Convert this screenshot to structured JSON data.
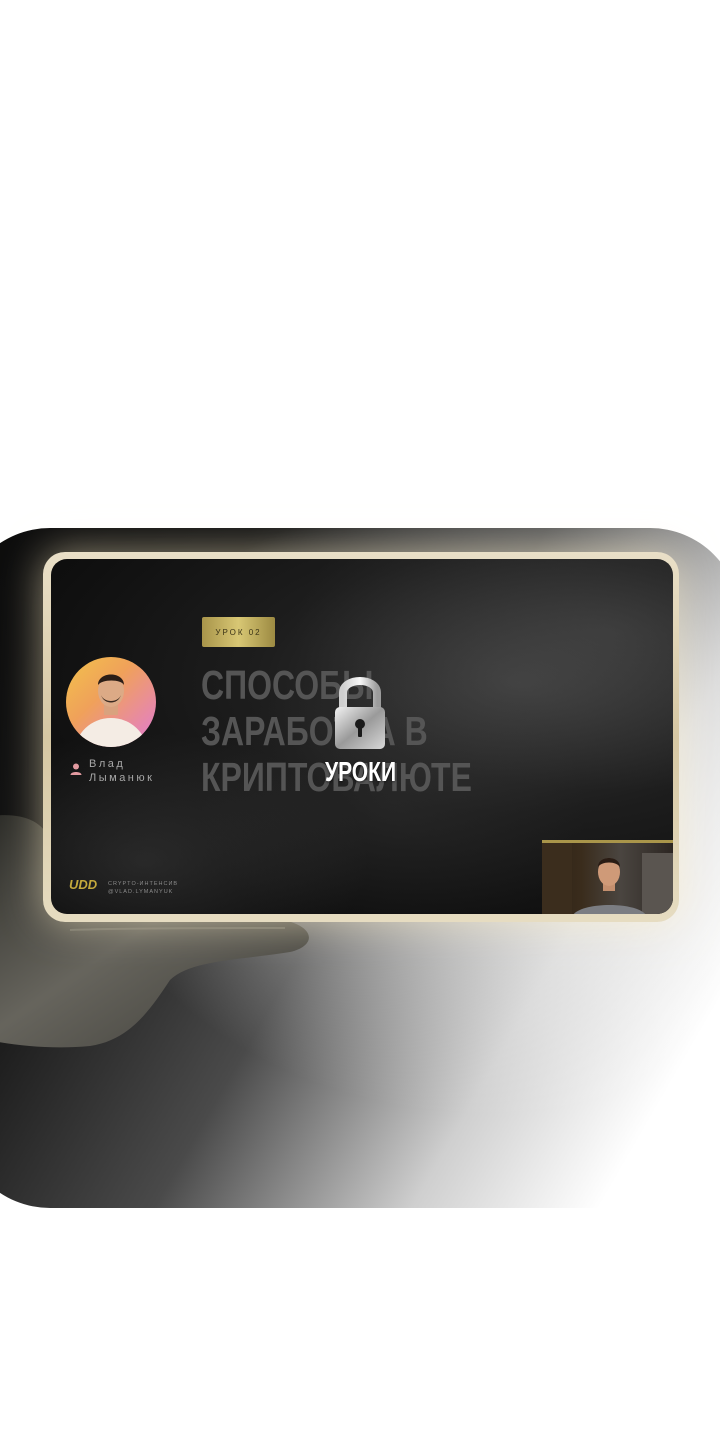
{
  "lesson": {
    "badge": "УРОК 02",
    "title_lines": [
      "СПОСОБЫ",
      "ЗАРАБОТКА В",
      "КРИПТОВАЛЮТЕ"
    ]
  },
  "author": {
    "first_name": "Влад",
    "last_name": "Лыманюк"
  },
  "brand": {
    "logo": "UDD",
    "line1": "CRYPTO-ИНТЕНСИВ",
    "line2": "@VLAD.LYMANYUK"
  },
  "lock_overlay": {
    "label": "УРОКИ",
    "icon": "padlock-icon"
  },
  "colors": {
    "gold": "#c9b35c",
    "card_frame": "#e0d3b2",
    "screen_bg": "#111111"
  }
}
